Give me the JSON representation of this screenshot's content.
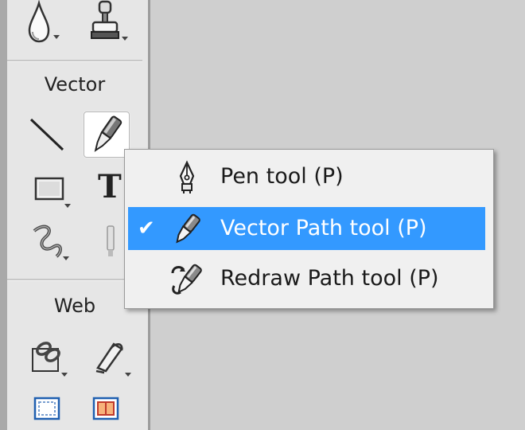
{
  "tool_panel": {
    "sections": {
      "vector": "Vector",
      "web": "Web"
    },
    "text_tool_glyph": "T",
    "tools": [
      {
        "name": "blur-tool",
        "icon": "water-drop-icon"
      },
      {
        "name": "rubber-stamp-tool",
        "icon": "stamp-icon"
      },
      {
        "name": "line-tool",
        "icon": "line-icon"
      },
      {
        "name": "pen-tool",
        "icon": "vector-pen-icon",
        "selected": true
      },
      {
        "name": "rectangle-tool",
        "icon": "rectangle-icon"
      },
      {
        "name": "text-tool",
        "icon": "text-icon"
      },
      {
        "name": "freeform-tool",
        "icon": "freeform-icon"
      },
      {
        "name": "knife-tool",
        "icon": "knife-icon"
      },
      {
        "name": "hotspot-tool",
        "icon": "hotspot-icon"
      },
      {
        "name": "slice-tool",
        "icon": "slice-icon"
      },
      {
        "name": "hide-hotspots-button",
        "icon": "hide-slices-icon"
      },
      {
        "name": "show-hotspots-button",
        "icon": "show-slices-icon"
      }
    ]
  },
  "pen_tool_menu": {
    "items": [
      {
        "label": "Pen tool (P)",
        "icon": "pen-nib-icon",
        "checked": false,
        "highlighted": false
      },
      {
        "label": "Vector Path tool (P)",
        "icon": "vector-path-brush-icon",
        "checked": true,
        "highlighted": true
      },
      {
        "label": "Redraw Path tool (P)",
        "icon": "redraw-path-icon",
        "checked": false,
        "highlighted": false
      }
    ],
    "check_glyph": "✔",
    "colors": {
      "highlight": "#3399ff",
      "menu_background": "#f0f0f0",
      "menu_border": "#9a9a9a"
    }
  }
}
